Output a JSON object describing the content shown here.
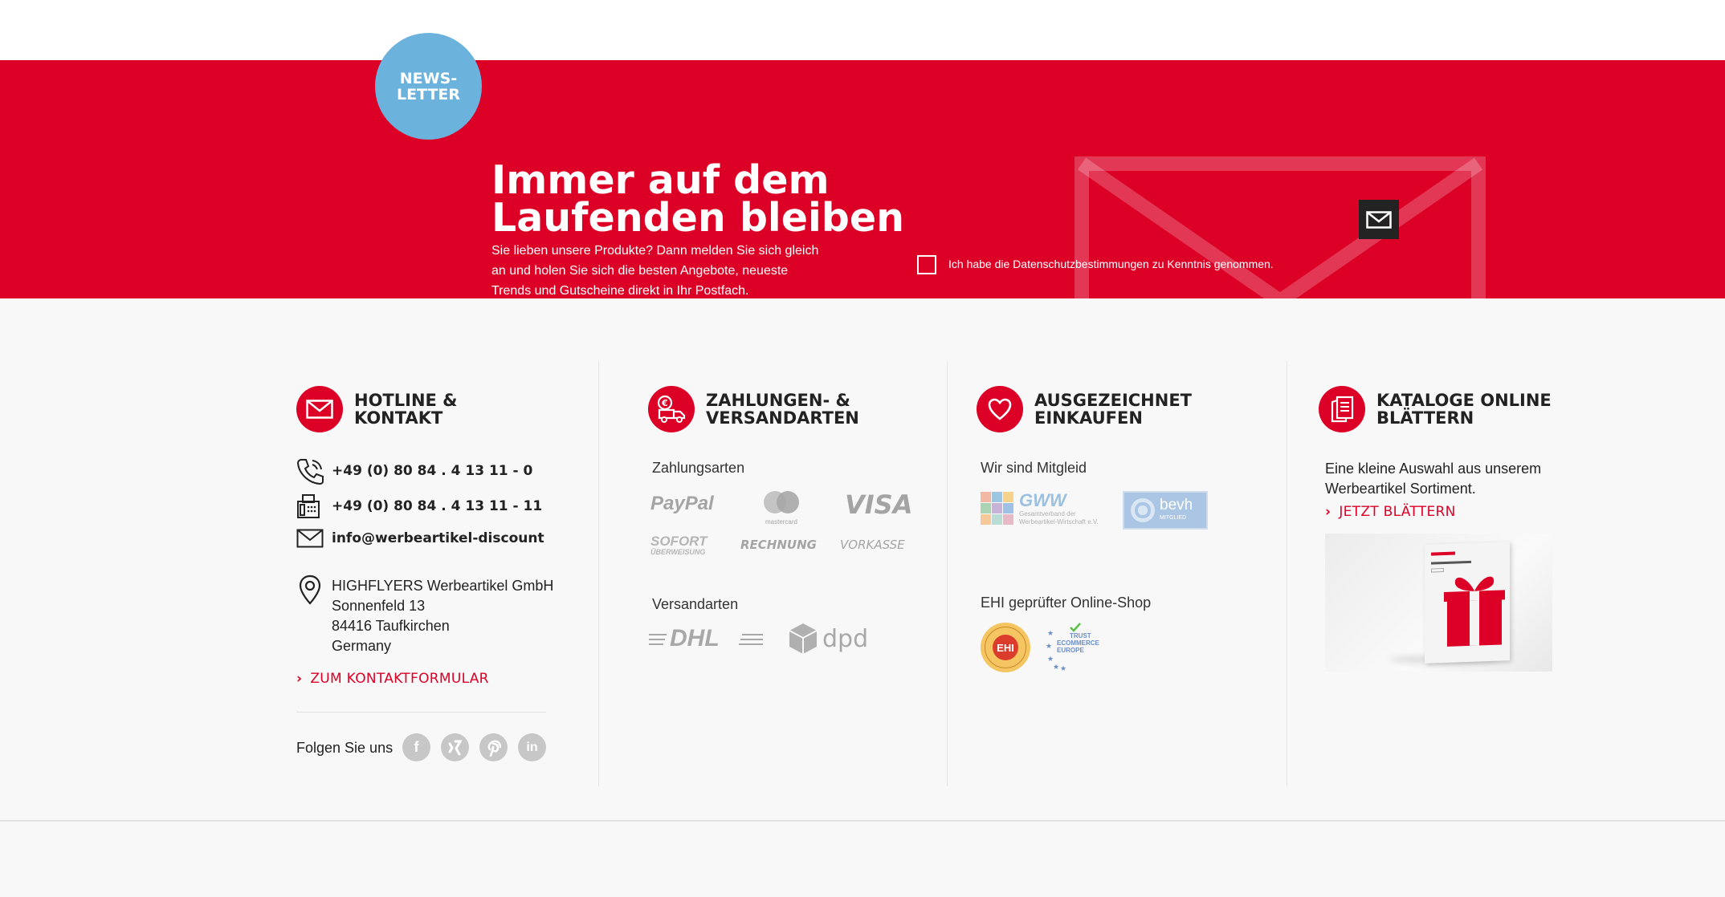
{
  "newsletter": {
    "badge": "NEWS-LETTER",
    "title_line1": "Immer auf dem",
    "title_line2": "Laufenden bleiben",
    "text": "Sie lieben unsere Produkte? Dann melden Sie sich gleich an und holen Sie sich die besten Angebote, neueste Trends und Gutscheine direkt in Ihr Postfach.",
    "privacy_label": "Ich habe die Datenschutzbestimmungen zu Kenntnis genommen.",
    "send_icon": "envelope-icon",
    "accent": "#dc0026",
    "badge_color": "#6bb2dc"
  },
  "hotline": {
    "title_line1": "HOTLINE &",
    "title_line2": "KONTAKT",
    "phone": "+49 (0) 80 84 . 4 13 11 - 0",
    "fax": "+49 (0) 80 84 . 4 13 11 - 11",
    "email": "info@werbeartikel-discount",
    "address": [
      "HIGHFLYERS Werbeartikel GmbH",
      "Sonnenfeld 13",
      "84416 Taufkirchen",
      "Germany"
    ],
    "contact_link": "ZUM KONTAKTFORMULAR",
    "follow": "Folgen Sie uns",
    "social": [
      "facebook-icon",
      "xing-icon",
      "pinterest-icon",
      "linkedin-icon"
    ]
  },
  "payment": {
    "title_line1": "ZAHLUNGEN- &",
    "title_line2": "VERSANDARTEN",
    "payment_label": "Zahlungsarten",
    "payment_logos": [
      "PayPal",
      "mastercard",
      "VISA",
      "SOFORT",
      "ÜBERWEISUNG",
      "RECHNUNG",
      "VORKASSE"
    ],
    "shipping_label": "Versandarten",
    "shipping_logos": [
      "DHL",
      "dpd"
    ]
  },
  "awards": {
    "title_line1": "AUSGEZEICHNET",
    "title_line2": "EINKAUFEN",
    "member_label": "Wir sind Mitgleid",
    "gww": "GWW",
    "gww_sub1": "Gesamtverband der",
    "gww_sub2": "Werbeartikel-Wirtschaft e.V.",
    "bevh": "bevh",
    "bevh_sub": "MITGLIED",
    "ehi_label": "EHI geprüfter Online-Shop",
    "ehi_badge": "EHI",
    "ehi_ring": "GEPRÜFTER ONLINE-SHOP",
    "trust": [
      "TRUST",
      "ECOMMERCE",
      "EUROPE"
    ]
  },
  "catalog": {
    "title_line1": "KATALOGE ONLINE",
    "title_line2": "BLÄTTERN",
    "text": "Eine kleine Auswahl aus unserem Werbeartikel Sortiment.",
    "link": "JETZT BLÄTTERN"
  }
}
